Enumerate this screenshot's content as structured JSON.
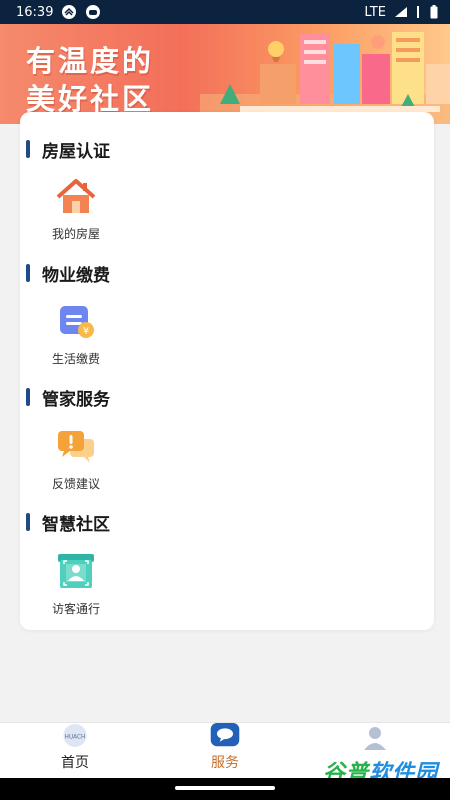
{
  "status_bar": {
    "time": "16:39",
    "network": "LTE"
  },
  "banner": {
    "line1": "有温度的",
    "line2": "美好社区"
  },
  "sections": [
    {
      "title": "房屋认证",
      "items": [
        {
          "label": "我的房屋",
          "icon": "house-icon"
        }
      ]
    },
    {
      "title": "物业缴费",
      "items": [
        {
          "label": "生活缴费",
          "icon": "bill-icon"
        }
      ]
    },
    {
      "title": "管家服务",
      "items": [
        {
          "label": "反馈建议",
          "icon": "feedback-icon"
        }
      ]
    },
    {
      "title": "智慧社区",
      "items": [
        {
          "label": "访客通行",
          "icon": "visitor-icon"
        }
      ]
    }
  ],
  "bottom_nav": {
    "items": [
      {
        "label": "首页",
        "icon": "home-logo-icon",
        "active": false
      },
      {
        "label": "服务",
        "icon": "service-icon",
        "active": true
      },
      {
        "label": "",
        "icon": "profile-icon",
        "active": false
      }
    ]
  },
  "watermark": {
    "part1": "谷普",
    "part2": "软件园"
  },
  "colors": {
    "accent": "#1e4a87",
    "active_tab": "#c4702c",
    "banner": "#f36f5a"
  }
}
